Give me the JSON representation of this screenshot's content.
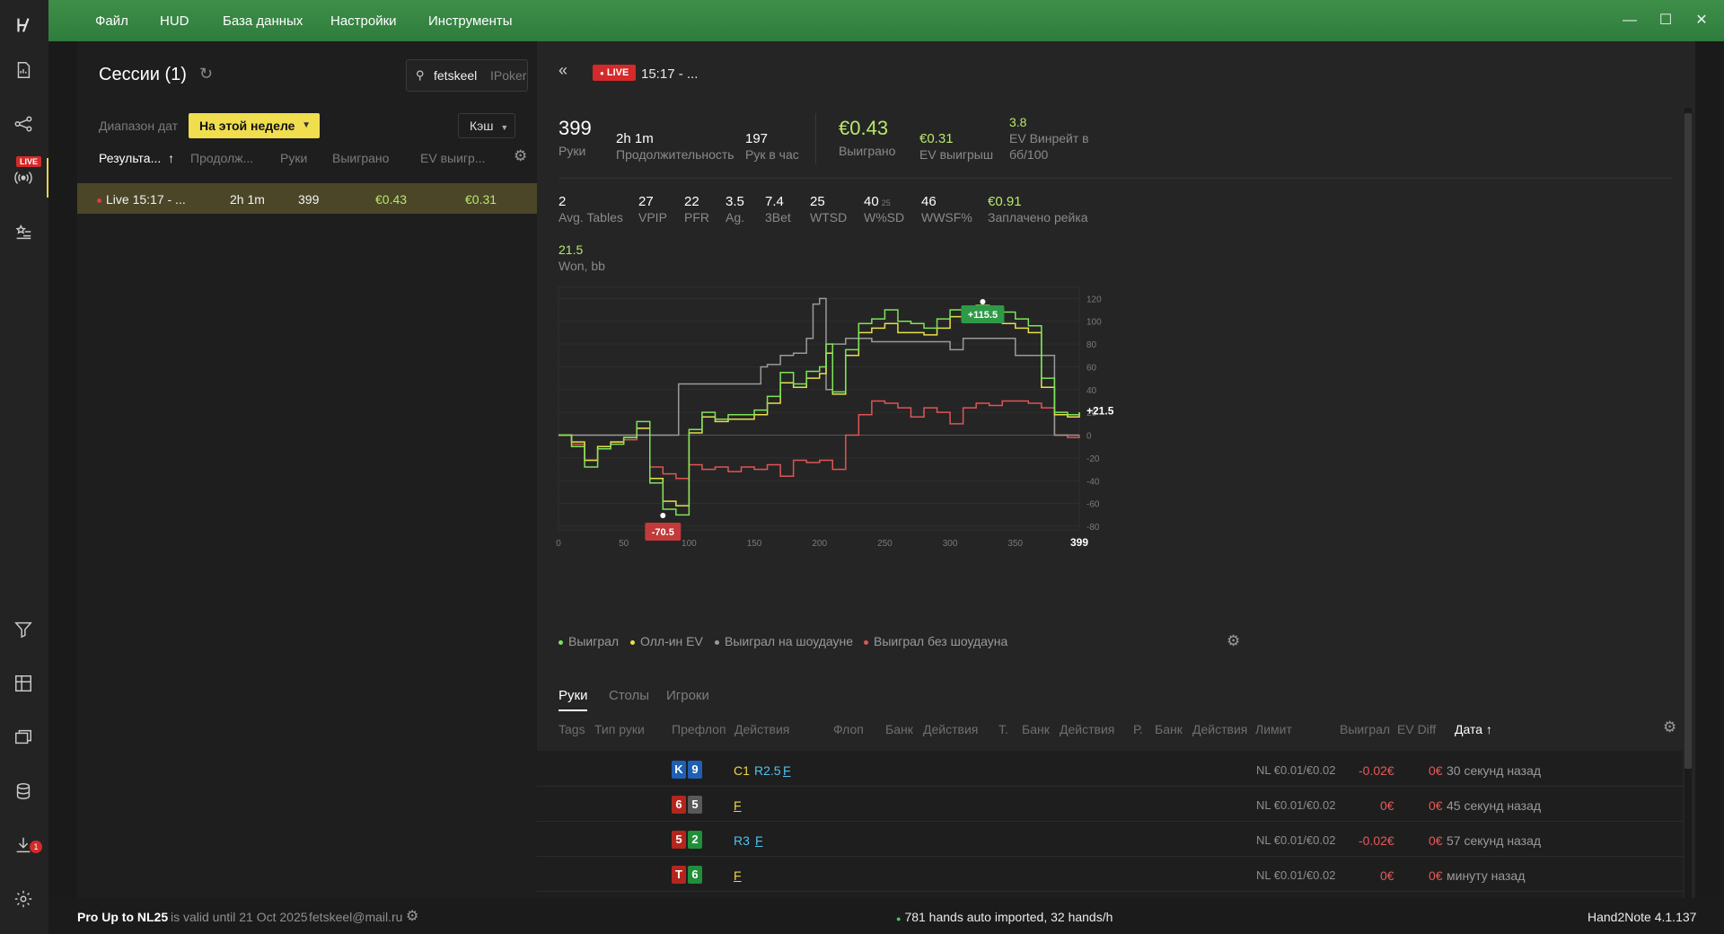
{
  "menu": [
    "Файл",
    "HUD",
    "База данных",
    "Настройки",
    "Инструменты"
  ],
  "sidebar": {
    "live_badge": "LIVE",
    "download_count": "1"
  },
  "sessions": {
    "title": "Сессии (1)",
    "user": {
      "name": "fetskeel",
      "site": "IPoker"
    },
    "date_label": "Диапазон дат",
    "date_value": "На этой неделе",
    "cash_label": "Кэш",
    "columns": [
      "Результа...",
      "Продолж...",
      "Руки",
      "Выиграно",
      "EV выигр..."
    ],
    "sort_arrow": "↑",
    "rows": [
      {
        "name": "Live 15:17 - ...",
        "duration": "2h 1m",
        "hands": "399",
        "won": "€0.43",
        "ev": "€0.31"
      }
    ]
  },
  "detail": {
    "live": "LIVE",
    "time": "15:17 - ...",
    "stats_top": [
      {
        "value": "399",
        "label": "Руки"
      },
      {
        "value": "2h 1m",
        "label": "Продолжительность"
      },
      {
        "value": "197",
        "label": "Рук в час"
      },
      {
        "value": "€0.43",
        "label": "Выиграно"
      },
      {
        "value": "€0.31",
        "label": "EV выигрыш"
      },
      {
        "value": "3.8",
        "label1": "EV Винрейт в",
        "label2": "бб/100"
      }
    ],
    "stats_mid": [
      {
        "value": "2",
        "label": "Avg. Tables"
      },
      {
        "value": "27",
        "label": "VPIP"
      },
      {
        "value": "22",
        "label": "PFR"
      },
      {
        "value": "3.5",
        "label": "Ag."
      },
      {
        "value": "7.4",
        "label": "3Bet"
      },
      {
        "value": "25",
        "label": "WTSD"
      },
      {
        "value": "40",
        "sub": "25",
        "label": "W%SD"
      },
      {
        "value": "46",
        "label": "WWSF%"
      },
      {
        "value": "€0.91",
        "label": "Заплачено рейка"
      }
    ],
    "won_bb": {
      "value": "21.5",
      "label": "Won, bb"
    },
    "legend": [
      "Выиграл",
      "Олл-ин EV",
      "Выиграл на шоудауне",
      "Выиграл без шоудауна"
    ],
    "tabs": [
      "Руки",
      "Столы",
      "Игроки"
    ],
    "hand_columns": [
      "Tags",
      "Тип руки",
      "Префлоп",
      "Действия",
      "Флоп",
      "Банк",
      "Действия",
      "Т.",
      "Банк",
      "Действия",
      "Р.",
      "Банк",
      "Действия",
      "Лимит",
      "Выиграл",
      "EV Diff",
      "Дата ↑"
    ],
    "hands": [
      {
        "c1": "K",
        "c2": "9",
        "act1": "C1",
        "act2": "R2.5",
        "act3": "F",
        "limit": "NL €0.01/€0.02",
        "won": "-0.02€",
        "evdiff": "0€",
        "date": "30 секунд назад"
      },
      {
        "c1": "6",
        "c2": "5",
        "act1": "F",
        "limit": "NL €0.01/€0.02",
        "won": "0€",
        "evdiff": "0€",
        "date": "45 секунд назад"
      },
      {
        "c1": "5",
        "c2": "2",
        "act1": "R3",
        "act2": "F",
        "limit": "NL €0.01/€0.02",
        "won": "-0.02€",
        "evdiff": "0€",
        "date": "57 секунд назад"
      },
      {
        "c1": "T",
        "c2": "6",
        "act1": "F",
        "limit": "NL €0.01/€0.02",
        "won": "0€",
        "evdiff": "0€",
        "date": "минуту назад"
      }
    ]
  },
  "status": {
    "license": "Pro Up to NL25",
    "valid": "is valid until 21 Oct 2025",
    "email": "fetskeel@mail.ru",
    "import": "781 hands auto imported, 32 hands/h",
    "version": "Hand2Note 4.1.137"
  },
  "chart_data": {
    "type": "line",
    "x_ticks": [
      "0",
      "50",
      "100",
      "150",
      "200",
      "250",
      "300",
      "350",
      "399"
    ],
    "y_ticks": [
      "120",
      "100",
      "80",
      "60",
      "40",
      "20",
      "0",
      "-20",
      "-40",
      "-60",
      "-80"
    ],
    "xlim": [
      0,
      399
    ],
    "ylim": [
      -80,
      125
    ],
    "annotations": {
      "max_label": "+115.5",
      "min_label": "-70.5",
      "end_label": "+21.5"
    },
    "series": [
      {
        "color": "#7ee35a",
        "x": [
          0,
          10,
          20,
          30,
          40,
          50,
          60,
          70,
          80,
          90,
          100,
          110,
          120,
          130,
          140,
          150,
          160,
          170,
          180,
          190,
          200,
          205,
          210,
          220,
          230,
          240,
          250,
          260,
          270,
          280,
          290,
          300,
          310,
          320,
          330,
          340,
          350,
          360,
          370,
          380,
          390,
          399
        ],
        "y": [
          0,
          -10,
          -28,
          -12,
          -8,
          -2,
          12,
          -42,
          -65,
          -70,
          5,
          20,
          14,
          18,
          18,
          22,
          34,
          55,
          45,
          56,
          60,
          80,
          38,
          75,
          98,
          102,
          110,
          100,
          98,
          94,
          102,
          110,
          112,
          114,
          108,
          108,
          102,
          96,
          50,
          20,
          18,
          20
        ]
      },
      {
        "color": "#e6e04a",
        "x": [
          0,
          10,
          20,
          30,
          40,
          50,
          60,
          70,
          80,
          90,
          100,
          110,
          120,
          130,
          140,
          150,
          160,
          170,
          180,
          190,
          200,
          205,
          210,
          220,
          230,
          240,
          250,
          260,
          270,
          280,
          290,
          300,
          310,
          320,
          330,
          340,
          350,
          360,
          370,
          380,
          390,
          399
        ],
        "y": [
          0,
          -6,
          -22,
          -10,
          -6,
          -2,
          6,
          -38,
          -58,
          -62,
          2,
          16,
          12,
          14,
          14,
          18,
          28,
          46,
          42,
          50,
          54,
          72,
          36,
          70,
          90,
          94,
          98,
          90,
          90,
          88,
          94,
          104,
          106,
          108,
          100,
          98,
          94,
          90,
          42,
          18,
          16,
          20
        ]
      },
      {
        "color": "#9a9a9a",
        "x": [
          0,
          20,
          40,
          60,
          80,
          90,
          92,
          100,
          120,
          140,
          150,
          155,
          160,
          170,
          180,
          190,
          195,
          200,
          205,
          210,
          220,
          240,
          260,
          280,
          300,
          310,
          320,
          330,
          340,
          350,
          360,
          370,
          380,
          399
        ],
        "y": [
          0,
          0,
          0,
          0,
          0,
          0,
          45,
          45,
          45,
          45,
          45,
          60,
          62,
          70,
          72,
          85,
          115,
          120,
          40,
          80,
          85,
          82,
          82,
          82,
          75,
          85,
          85,
          85,
          85,
          70,
          70,
          70,
          0,
          0
        ]
      },
      {
        "color": "#e05555",
        "x": [
          0,
          10,
          20,
          30,
          40,
          50,
          60,
          70,
          80,
          90,
          100,
          110,
          120,
          130,
          140,
          150,
          160,
          170,
          180,
          190,
          200,
          210,
          220,
          230,
          240,
          250,
          260,
          270,
          280,
          290,
          300,
          310,
          320,
          330,
          340,
          350,
          360,
          370,
          380,
          390,
          399
        ],
        "y": [
          0,
          -8,
          -22,
          -10,
          -6,
          -4,
          6,
          -28,
          -34,
          -38,
          -26,
          -30,
          -28,
          -32,
          -28,
          -30,
          -26,
          -36,
          -22,
          -24,
          -22,
          -30,
          0,
          18,
          30,
          28,
          24,
          16,
          24,
          20,
          10,
          24,
          28,
          26,
          30,
          30,
          28,
          24,
          0,
          -2,
          0
        ]
      }
    ]
  }
}
